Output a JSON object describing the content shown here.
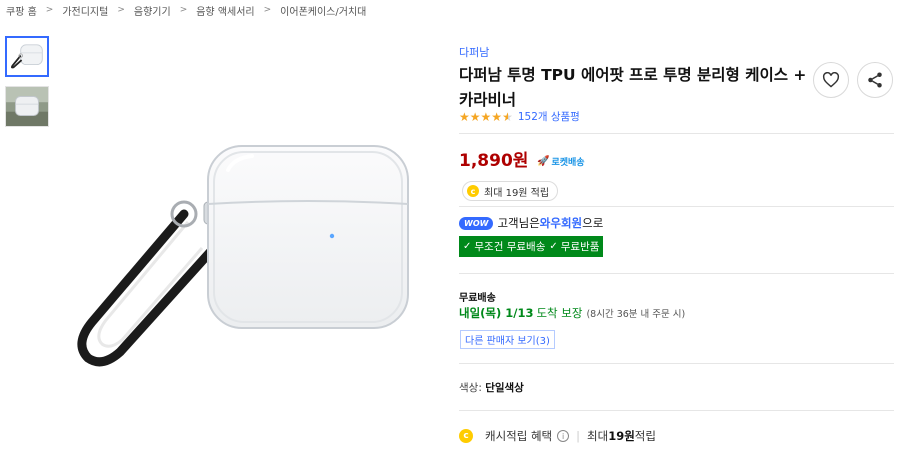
{
  "breadcrumb": [
    "쿠팡 홈",
    "가전디지털",
    "음향기기",
    "음향 액세서리",
    "이어폰케이스/거치대"
  ],
  "product": {
    "brand": "다퍼남",
    "title": "다퍼남 투명 TPU 에어팟 프로 투명 분리형 케이스 + 카라비너",
    "rating": 4.5,
    "review_count_text": "152개 상품평"
  },
  "icons": {
    "favorite": "heart-icon",
    "share": "share-icon",
    "star": "star-icon",
    "rocket": "rocket-icon",
    "coin": "coin-icon",
    "info": "info-icon",
    "check": "check-icon"
  },
  "price": {
    "amount": "1,890",
    "unit": "원",
    "rocket_label": "로켓배송"
  },
  "reward": {
    "coin_symbol": "c",
    "text": "최대 19원 적립"
  },
  "wow": {
    "badge": "WOW",
    "prefix": "고객님은 ",
    "member": "와우회원",
    "suffix": "으로"
  },
  "benefits": {
    "check": "✓",
    "items": [
      "무조건 무료배송",
      "무료반품"
    ]
  },
  "shipping": {
    "label": "무료배송",
    "date": "내일(목) 1/13",
    "arrival": "도착 보장",
    "deadline": "(8시간 36분 내 주문 시)"
  },
  "other_sellers": "다른 판매자 보기(3)",
  "option": {
    "label": "색상: ",
    "value": "단일색상"
  },
  "cash": {
    "label": "캐시적립 혜택",
    "info": "i",
    "separator": "|",
    "prefix": "최대 ",
    "amount": "19원",
    "suffix": " 적립"
  },
  "colors": {
    "accent_blue": "#346aff",
    "price_red": "#ae0000",
    "green": "#00891a",
    "star": "#f5a623",
    "rocket": "#1994e6",
    "coin": "#ffcc00"
  }
}
